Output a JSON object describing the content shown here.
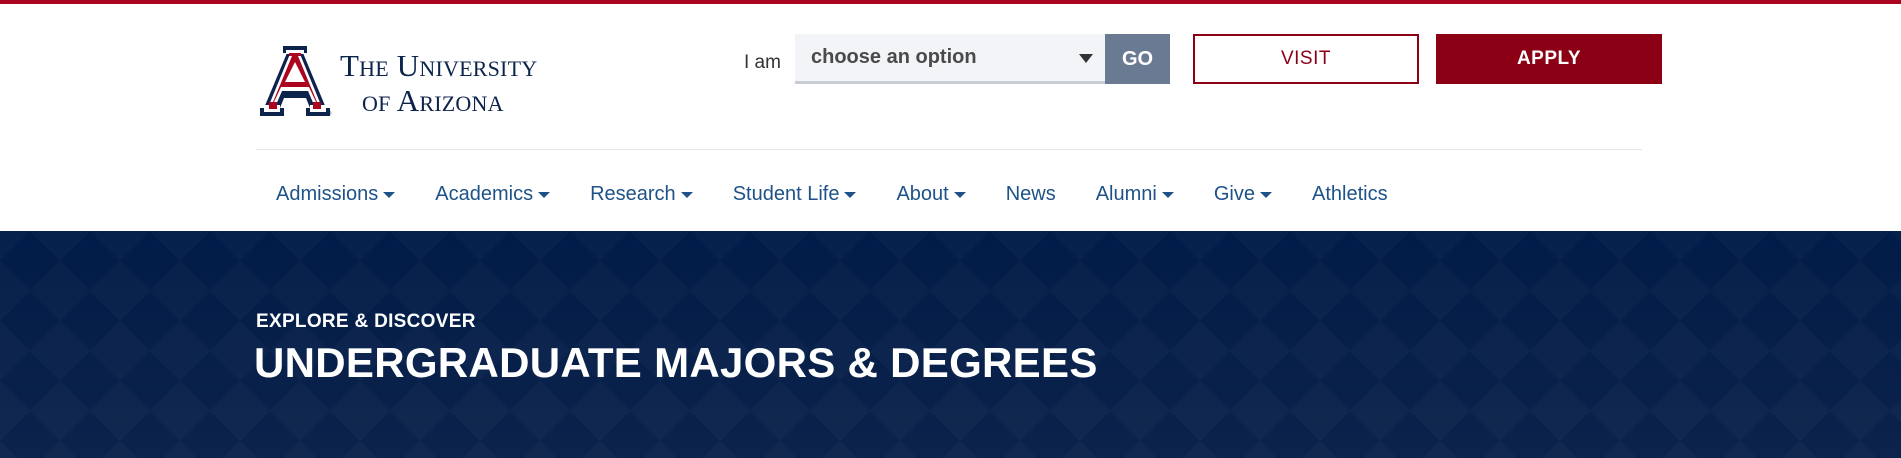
{
  "brand": {
    "name_line1": "The University",
    "name_line2": "of Arizona",
    "colors": {
      "red": "#ab0520",
      "navy": "#0c234b",
      "blue": "#1e5288"
    }
  },
  "audience_selector": {
    "label": "I am",
    "selected": "choose an option",
    "go_label": "GO"
  },
  "cta": {
    "visit_label": "VISIT",
    "apply_label": "APPLY"
  },
  "nav": {
    "items": [
      {
        "label": "Admissions",
        "has_dropdown": true
      },
      {
        "label": "Academics",
        "has_dropdown": true
      },
      {
        "label": "Research",
        "has_dropdown": true
      },
      {
        "label": "Student Life",
        "has_dropdown": true
      },
      {
        "label": "About",
        "has_dropdown": true
      },
      {
        "label": "News",
        "has_dropdown": false
      },
      {
        "label": "Alumni",
        "has_dropdown": true
      },
      {
        "label": "Give",
        "has_dropdown": true
      },
      {
        "label": "Athletics",
        "has_dropdown": false
      }
    ]
  },
  "hero": {
    "eyebrow": "EXPLORE & DISCOVER",
    "title": "UNDERGRADUATE MAJORS & DEGREES"
  }
}
